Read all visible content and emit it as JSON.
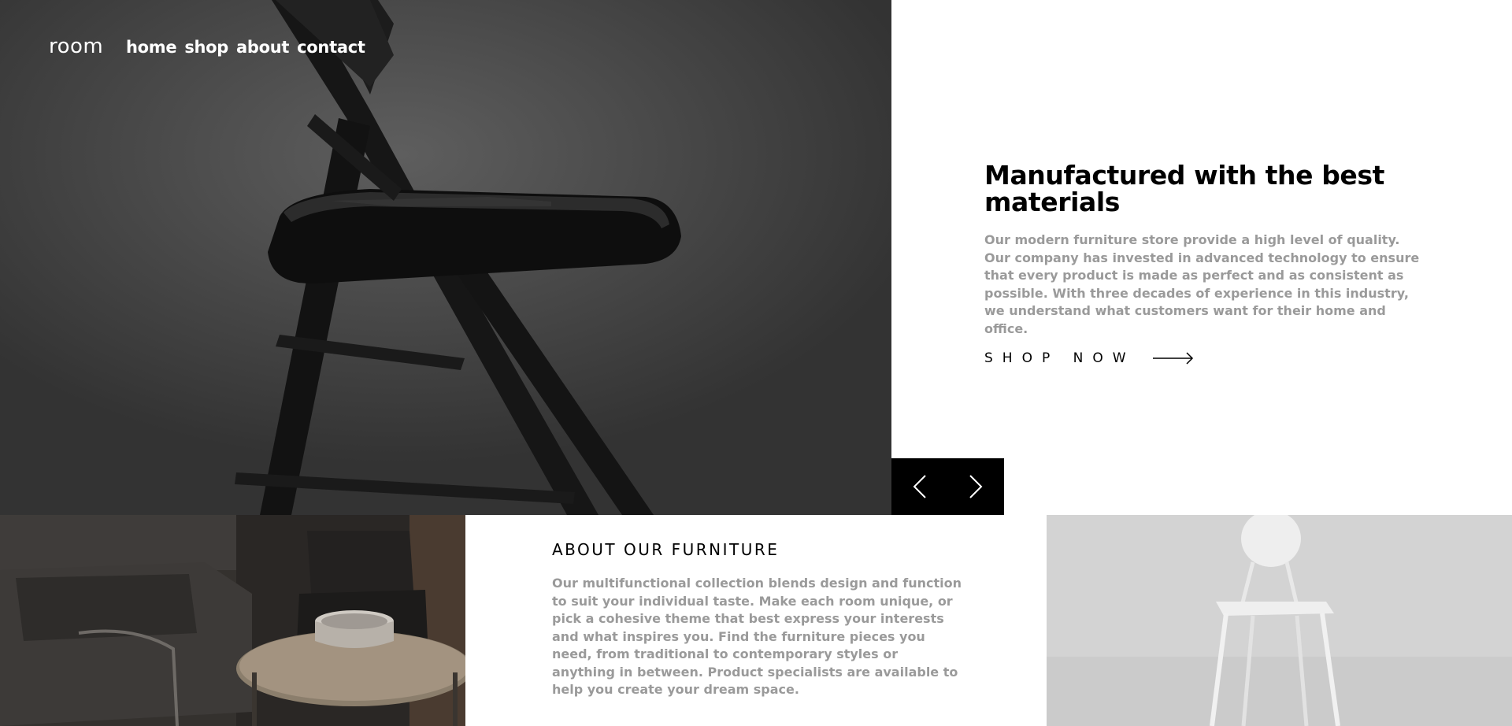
{
  "header": {
    "logo": "room",
    "nav": [
      {
        "label": "home"
      },
      {
        "label": "shop"
      },
      {
        "label": "about"
      },
      {
        "label": "contact"
      }
    ]
  },
  "hero": {
    "title": "Manufactured with the best materials",
    "description": "Our modern furniture store provide a high level of quality. Our company has invested in advanced technology to ensure that every product is made as perfect and as consistent as possible. With three decades of experience in this industry, we understand what customers want for their home and office.",
    "cta_label": "SHOP NOW",
    "cta_icon": "arrow-right-icon",
    "image": "black-folding-chair-photo"
  },
  "slider": {
    "prev_icon": "chevron-left-icon",
    "next_icon": "chevron-right-icon"
  },
  "about": {
    "title": "ABOUT OUR FURNITURE",
    "description": "Our multifunctional collection blends design and function to suit your individual taste. Make each room unique, or pick a cohesive theme that best express your interests and what inspires you. Find the furniture pieces you need, from traditional to contemporary styles or anything in between. Product specialists are available to help you create your dream space."
  },
  "images": {
    "bottom_left": "dark-living-room-armchairs-photo",
    "bottom_right": "white-chair-photo"
  },
  "colors": {
    "text_primary": "#000000",
    "text_secondary": "#9a9a9a",
    "control_bg": "#000000",
    "nav_text": "#ffffff"
  }
}
